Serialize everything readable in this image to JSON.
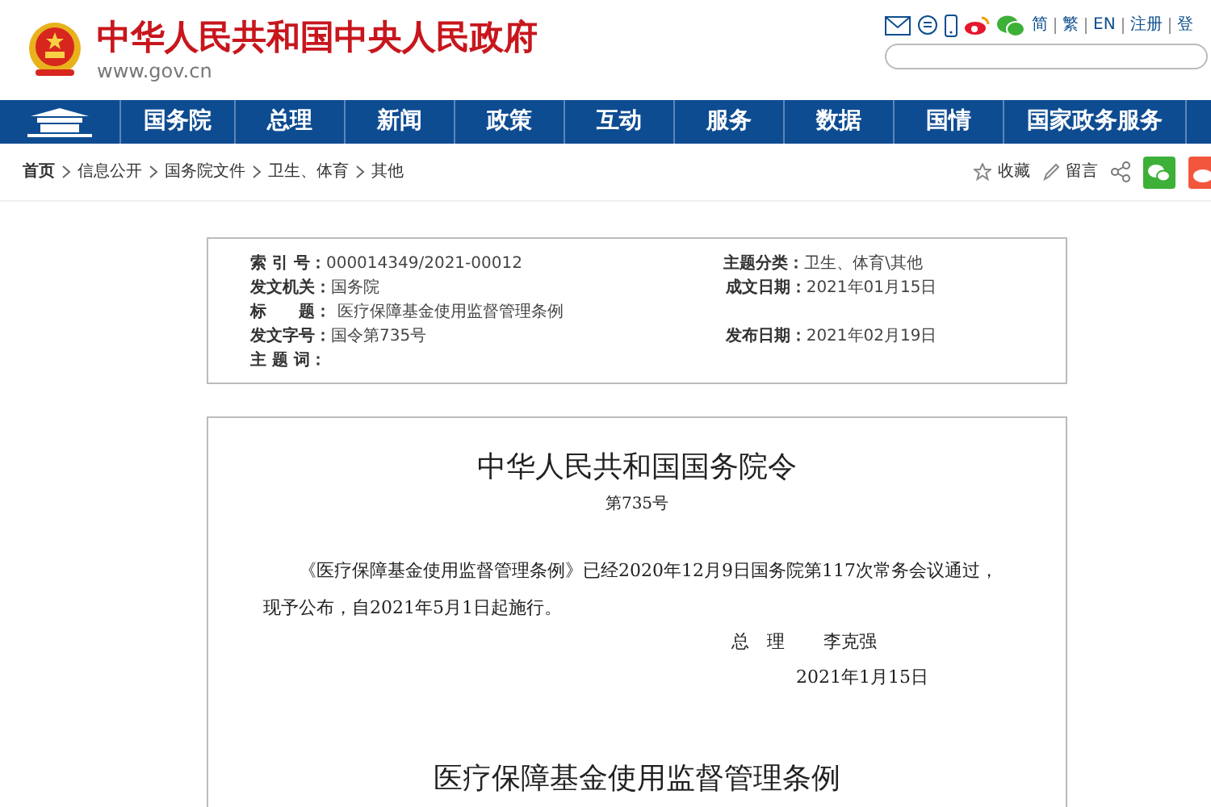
{
  "header": {
    "title": "中华人民共和国中央人民政府",
    "url": "www.gov.cn",
    "links": [
      "简",
      "繁",
      "EN",
      "注册",
      "登"
    ]
  },
  "nav": {
    "items": [
      "国务院",
      "总理",
      "新闻",
      "政策",
      "互动",
      "服务",
      "数据",
      "国情",
      "国家政务服务"
    ]
  },
  "breadcrumb": [
    "首页",
    "信息公开",
    "国务院文件",
    "卫生、体育",
    "其他"
  ],
  "actions": [
    "收藏",
    "留言"
  ],
  "meta": [
    {
      "label": "索 引 号：",
      "value": "000014349/2021-00012",
      "label_2": "主题分类：",
      "value_2": "卫生、体育\\其他"
    },
    {
      "label": "发文机关：",
      "value": "国务院",
      "label_2": "成文日期：",
      "value_2": "2021年01月15日"
    },
    {
      "label": "标　　题：",
      "value": "医疗保障基金使用监督管理条例"
    },
    {
      "label": "发文字号：",
      "value": "国令第735号",
      "label_2": "发布日期：",
      "value_2": "2021年02月19日"
    },
    {
      "label": "主 题 词："
    }
  ],
  "document": {
    "title": "中华人民共和国国务院令",
    "number": "第735号",
    "paragraph": "《医疗保障基金使用监督管理条例》已经2020年12月9日国务院第117次常务会议通过，现予公布，自2021年5月1日起施行。",
    "signer_title": "总　理",
    "signer_name": "李克强",
    "date": "2021年1月15日",
    "subtitle": "医疗保障基金使用监督管理条例"
  }
}
